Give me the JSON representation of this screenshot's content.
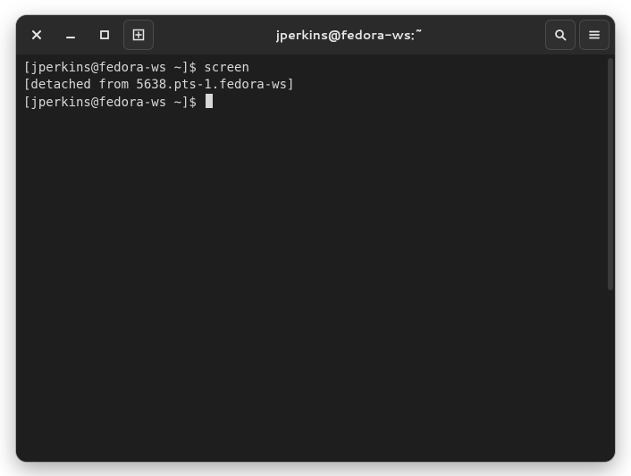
{
  "window": {
    "title": "jperkins@fedora-ws:~"
  },
  "terminal": {
    "lines": [
      {
        "prompt": "[jperkins@fedora-ws ~]$ ",
        "command": "screen"
      },
      {
        "text": "[detached from 5638.pts-1.fedora-ws]"
      },
      {
        "prompt": "[jperkins@fedora-ws ~]$ ",
        "command": "",
        "cursor": true
      }
    ]
  }
}
